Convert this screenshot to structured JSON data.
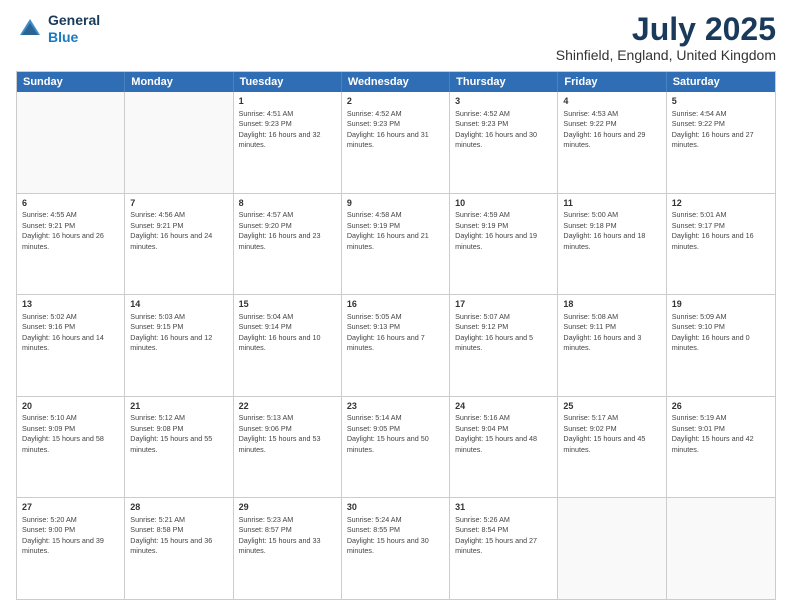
{
  "header": {
    "logo_line1": "General",
    "logo_line2": "Blue",
    "title": "July 2025",
    "subtitle": "Shinfield, England, United Kingdom"
  },
  "weekdays": [
    "Sunday",
    "Monday",
    "Tuesday",
    "Wednesday",
    "Thursday",
    "Friday",
    "Saturday"
  ],
  "rows": [
    [
      {
        "day": "",
        "sunrise": "",
        "sunset": "",
        "daylight": ""
      },
      {
        "day": "",
        "sunrise": "",
        "sunset": "",
        "daylight": ""
      },
      {
        "day": "1",
        "sunrise": "Sunrise: 4:51 AM",
        "sunset": "Sunset: 9:23 PM",
        "daylight": "Daylight: 16 hours and 32 minutes."
      },
      {
        "day": "2",
        "sunrise": "Sunrise: 4:52 AM",
        "sunset": "Sunset: 9:23 PM",
        "daylight": "Daylight: 16 hours and 31 minutes."
      },
      {
        "day": "3",
        "sunrise": "Sunrise: 4:52 AM",
        "sunset": "Sunset: 9:23 PM",
        "daylight": "Daylight: 16 hours and 30 minutes."
      },
      {
        "day": "4",
        "sunrise": "Sunrise: 4:53 AM",
        "sunset": "Sunset: 9:22 PM",
        "daylight": "Daylight: 16 hours and 29 minutes."
      },
      {
        "day": "5",
        "sunrise": "Sunrise: 4:54 AM",
        "sunset": "Sunset: 9:22 PM",
        "daylight": "Daylight: 16 hours and 27 minutes."
      }
    ],
    [
      {
        "day": "6",
        "sunrise": "Sunrise: 4:55 AM",
        "sunset": "Sunset: 9:21 PM",
        "daylight": "Daylight: 16 hours and 26 minutes."
      },
      {
        "day": "7",
        "sunrise": "Sunrise: 4:56 AM",
        "sunset": "Sunset: 9:21 PM",
        "daylight": "Daylight: 16 hours and 24 minutes."
      },
      {
        "day": "8",
        "sunrise": "Sunrise: 4:57 AM",
        "sunset": "Sunset: 9:20 PM",
        "daylight": "Daylight: 16 hours and 23 minutes."
      },
      {
        "day": "9",
        "sunrise": "Sunrise: 4:58 AM",
        "sunset": "Sunset: 9:19 PM",
        "daylight": "Daylight: 16 hours and 21 minutes."
      },
      {
        "day": "10",
        "sunrise": "Sunrise: 4:59 AM",
        "sunset": "Sunset: 9:19 PM",
        "daylight": "Daylight: 16 hours and 19 minutes."
      },
      {
        "day": "11",
        "sunrise": "Sunrise: 5:00 AM",
        "sunset": "Sunset: 9:18 PM",
        "daylight": "Daylight: 16 hours and 18 minutes."
      },
      {
        "day": "12",
        "sunrise": "Sunrise: 5:01 AM",
        "sunset": "Sunset: 9:17 PM",
        "daylight": "Daylight: 16 hours and 16 minutes."
      }
    ],
    [
      {
        "day": "13",
        "sunrise": "Sunrise: 5:02 AM",
        "sunset": "Sunset: 9:16 PM",
        "daylight": "Daylight: 16 hours and 14 minutes."
      },
      {
        "day": "14",
        "sunrise": "Sunrise: 5:03 AM",
        "sunset": "Sunset: 9:15 PM",
        "daylight": "Daylight: 16 hours and 12 minutes."
      },
      {
        "day": "15",
        "sunrise": "Sunrise: 5:04 AM",
        "sunset": "Sunset: 9:14 PM",
        "daylight": "Daylight: 16 hours and 10 minutes."
      },
      {
        "day": "16",
        "sunrise": "Sunrise: 5:05 AM",
        "sunset": "Sunset: 9:13 PM",
        "daylight": "Daylight: 16 hours and 7 minutes."
      },
      {
        "day": "17",
        "sunrise": "Sunrise: 5:07 AM",
        "sunset": "Sunset: 9:12 PM",
        "daylight": "Daylight: 16 hours and 5 minutes."
      },
      {
        "day": "18",
        "sunrise": "Sunrise: 5:08 AM",
        "sunset": "Sunset: 9:11 PM",
        "daylight": "Daylight: 16 hours and 3 minutes."
      },
      {
        "day": "19",
        "sunrise": "Sunrise: 5:09 AM",
        "sunset": "Sunset: 9:10 PM",
        "daylight": "Daylight: 16 hours and 0 minutes."
      }
    ],
    [
      {
        "day": "20",
        "sunrise": "Sunrise: 5:10 AM",
        "sunset": "Sunset: 9:09 PM",
        "daylight": "Daylight: 15 hours and 58 minutes."
      },
      {
        "day": "21",
        "sunrise": "Sunrise: 5:12 AM",
        "sunset": "Sunset: 9:08 PM",
        "daylight": "Daylight: 15 hours and 55 minutes."
      },
      {
        "day": "22",
        "sunrise": "Sunrise: 5:13 AM",
        "sunset": "Sunset: 9:06 PM",
        "daylight": "Daylight: 15 hours and 53 minutes."
      },
      {
        "day": "23",
        "sunrise": "Sunrise: 5:14 AM",
        "sunset": "Sunset: 9:05 PM",
        "daylight": "Daylight: 15 hours and 50 minutes."
      },
      {
        "day": "24",
        "sunrise": "Sunrise: 5:16 AM",
        "sunset": "Sunset: 9:04 PM",
        "daylight": "Daylight: 15 hours and 48 minutes."
      },
      {
        "day": "25",
        "sunrise": "Sunrise: 5:17 AM",
        "sunset": "Sunset: 9:02 PM",
        "daylight": "Daylight: 15 hours and 45 minutes."
      },
      {
        "day": "26",
        "sunrise": "Sunrise: 5:19 AM",
        "sunset": "Sunset: 9:01 PM",
        "daylight": "Daylight: 15 hours and 42 minutes."
      }
    ],
    [
      {
        "day": "27",
        "sunrise": "Sunrise: 5:20 AM",
        "sunset": "Sunset: 9:00 PM",
        "daylight": "Daylight: 15 hours and 39 minutes."
      },
      {
        "day": "28",
        "sunrise": "Sunrise: 5:21 AM",
        "sunset": "Sunset: 8:58 PM",
        "daylight": "Daylight: 15 hours and 36 minutes."
      },
      {
        "day": "29",
        "sunrise": "Sunrise: 5:23 AM",
        "sunset": "Sunset: 8:57 PM",
        "daylight": "Daylight: 15 hours and 33 minutes."
      },
      {
        "day": "30",
        "sunrise": "Sunrise: 5:24 AM",
        "sunset": "Sunset: 8:55 PM",
        "daylight": "Daylight: 15 hours and 30 minutes."
      },
      {
        "day": "31",
        "sunrise": "Sunrise: 5:26 AM",
        "sunset": "Sunset: 8:54 PM",
        "daylight": "Daylight: 15 hours and 27 minutes."
      },
      {
        "day": "",
        "sunrise": "",
        "sunset": "",
        "daylight": ""
      },
      {
        "day": "",
        "sunrise": "",
        "sunset": "",
        "daylight": ""
      }
    ]
  ]
}
